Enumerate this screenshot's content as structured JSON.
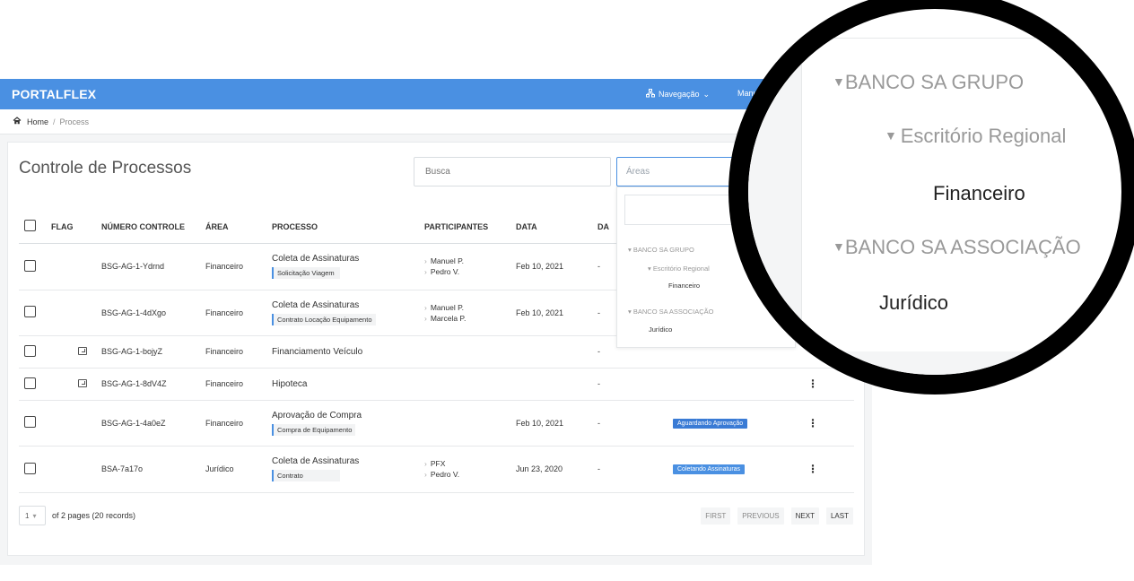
{
  "app": {
    "logo": "PORTALFLEX",
    "nav_label": "Navegação",
    "user_label": "Manue"
  },
  "breadcrumb": {
    "home": "Home",
    "separator": "/",
    "current": "Process"
  },
  "page": {
    "title": "Controle de Processos",
    "search_placeholder": "Busca",
    "areas_placeholder": "Áreas"
  },
  "table": {
    "headers": {
      "flag": "FLAG",
      "numero": "NÚMERO CONTROLE",
      "area": "ÁREA",
      "processo": "PROCESSO",
      "participantes": "PARTICIPANTES",
      "data": "DATA",
      "da": "DA"
    },
    "rows": [
      {
        "flag": false,
        "numero": "BSG-AG-1-Ydrnd",
        "area": "Financeiro",
        "processo": "Coleta de Assinaturas",
        "sub": "Solicitação Viagem",
        "p1": "Manuel P.",
        "p2": "Pedro V.",
        "data": "Feb 10, 2021",
        "da": "-",
        "status": "",
        "kebab": ""
      },
      {
        "flag": false,
        "numero": "BSG-AG-1-4dXgo",
        "area": "Financeiro",
        "processo": "Coleta de Assinaturas",
        "sub": "Contrato Locação Equipamento",
        "p1": "Manuel P.",
        "p2": "Marcela P.",
        "data": "Feb 10, 2021",
        "da": "-",
        "status": "",
        "kebab": ""
      },
      {
        "flag": true,
        "numero": "BSG-AG-1-bojyZ",
        "area": "Financeiro",
        "processo": "Financiamento Veículo",
        "sub": "",
        "p1": "",
        "p2": "",
        "data": "",
        "da": "-",
        "status": "",
        "kebab": ""
      },
      {
        "flag": true,
        "numero": "BSG-AG-1-8dV4Z",
        "area": "Financeiro",
        "processo": "Hipoteca",
        "sub": "",
        "p1": "",
        "p2": "",
        "data": "",
        "da": "-",
        "status": "",
        "kebab": "⋮"
      },
      {
        "flag": false,
        "numero": "BSG-AG-1-4a0eZ",
        "area": "Financeiro",
        "processo": "Aprovação de Compra",
        "sub": "Compra de Equipamento",
        "p1": "",
        "p2": "",
        "data": "Feb 10, 2021",
        "da": "-",
        "status": "Aguardando Aprovação",
        "kebab": "⋮"
      },
      {
        "flag": false,
        "numero": "BSA-7a17o",
        "area": "Jurídico",
        "processo": "Coleta de Assinaturas",
        "sub": "Contrato",
        "p1": "PFX",
        "p2": "Pedro V.",
        "data": "Jun 23, 2020",
        "da": "-",
        "status": "Coletando Assinaturas",
        "kebab": "⋮"
      }
    ]
  },
  "pagination": {
    "page": "1",
    "summary": "of 2 pages (20 records)",
    "first": "FIRST",
    "previous": "PREVIOUS",
    "next": "NEXT",
    "last": "LAST"
  },
  "dropdown": {
    "group1": "BANCO SA GRUPO",
    "group1_sub": "Escritório Regional",
    "leaf1": "Financeiro",
    "group2": "BANCO SA ASSOCIAÇÃO",
    "leaf2": "Jurídico"
  },
  "colors": {
    "accent": "#4a90e2",
    "status_aguardando": "#3a7bd5",
    "status_coletando": "#4a90e2"
  }
}
